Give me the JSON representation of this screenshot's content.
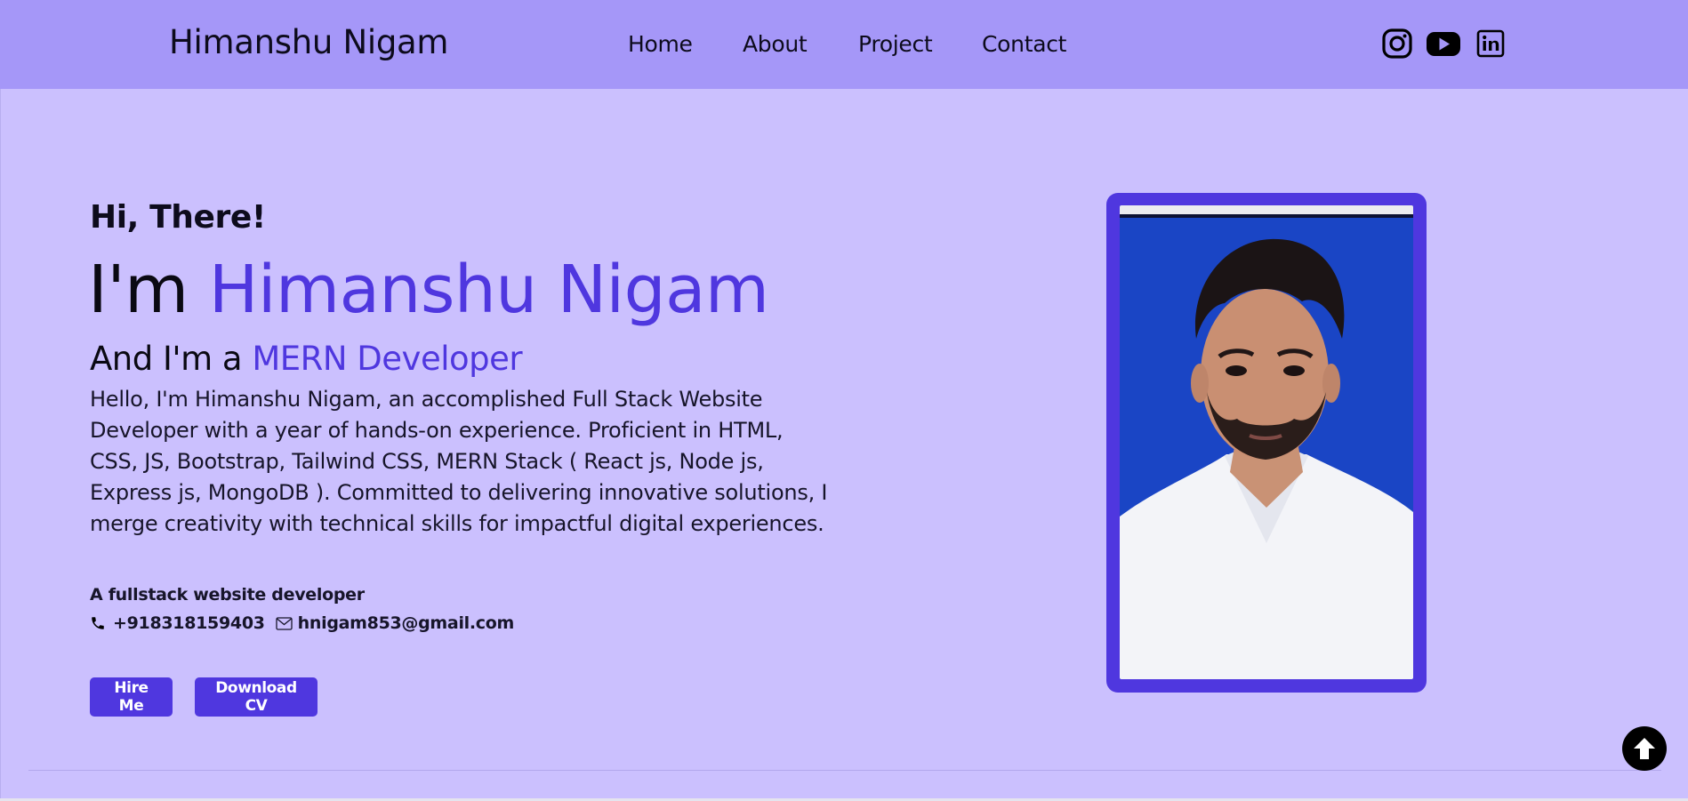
{
  "header": {
    "brand": "Himanshu Nigam",
    "nav": [
      {
        "label": "Home"
      },
      {
        "label": "About"
      },
      {
        "label": "Project"
      },
      {
        "label": "Contact"
      }
    ],
    "socials": [
      {
        "icon": "instagram-icon"
      },
      {
        "icon": "youtube-icon"
      },
      {
        "icon": "linkedin-icon"
      }
    ]
  },
  "hero": {
    "greeting": "Hi, There!",
    "title_prefix": "I'm ",
    "name": "Himanshu Nigam",
    "role_prefix": "And I'm a ",
    "role": "MERN Developer",
    "bio": "Hello, I'm Himanshu Nigam, an accomplished Full Stack Website Developer with a year of hands-on experience. Proficient in HTML, CSS, JS, Bootstrap, Tailwind CSS, MERN Stack ( React js, Node js, Express js, MongoDB ). Committed to delivering innovative solutions, I merge creativity with technical skills for impactful digital experiences.",
    "tagline": "A fullstack website developer",
    "phone": "+918318159403",
    "email": "hnigam853@gmail.com",
    "buttons": {
      "hire": "Hire Me",
      "cv": "Download CV"
    }
  },
  "colors": {
    "nav_bg": "#a597f8",
    "hero_bg": "#cbc0fe",
    "accent": "#4f37df",
    "photo_bg": "#1944c4"
  },
  "icons": {
    "phone": "phone-icon",
    "email": "mail-icon",
    "scroll_top": "arrow-up-circle-icon"
  }
}
